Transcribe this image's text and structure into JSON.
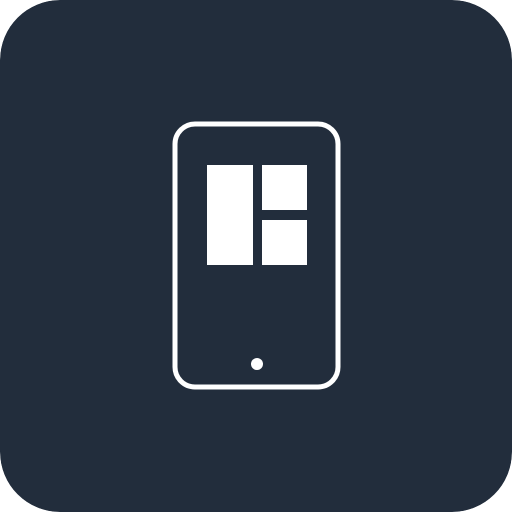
{
  "icon": {
    "name": "mobile-layout-app-icon",
    "glyph": "phone-with-layout-grid",
    "background_color": "#222d3c",
    "foreground_color": "#ffffff"
  }
}
